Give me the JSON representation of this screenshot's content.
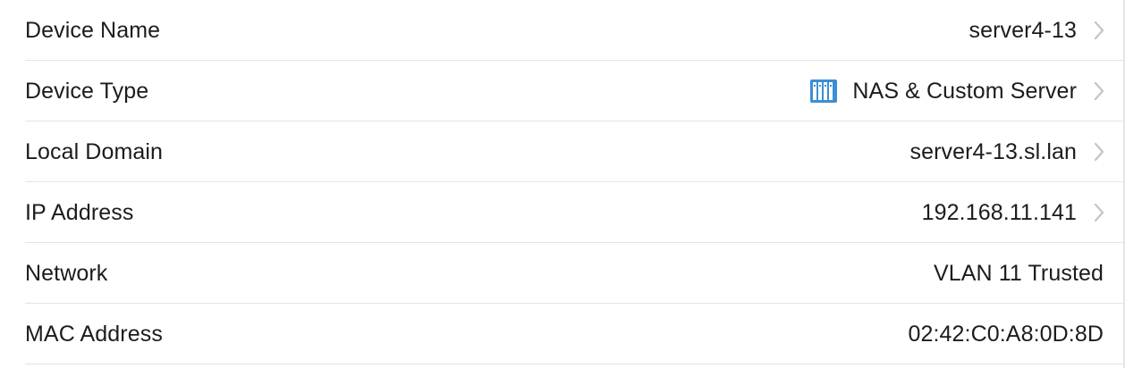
{
  "rows": [
    {
      "label": "Device Name",
      "value": "server4-13",
      "chevron": true
    },
    {
      "label": "Device Type",
      "value": "NAS & Custom Server",
      "chevron": true,
      "icon": "nas-server-icon"
    },
    {
      "label": "Local Domain",
      "value": "server4-13.sl.lan",
      "chevron": true
    },
    {
      "label": "IP Address",
      "value": "192.168.11.141",
      "chevron": true
    },
    {
      "label": "Network",
      "value": "VLAN 11 Trusted",
      "chevron": false
    },
    {
      "label": "MAC Address",
      "value": "02:42:C0:A8:0D:8D",
      "chevron": false
    }
  ],
  "colors": {
    "accent_icon": "#3a8fd6",
    "chevron": "#c4c4c7",
    "divider": "#e3e3e6"
  }
}
